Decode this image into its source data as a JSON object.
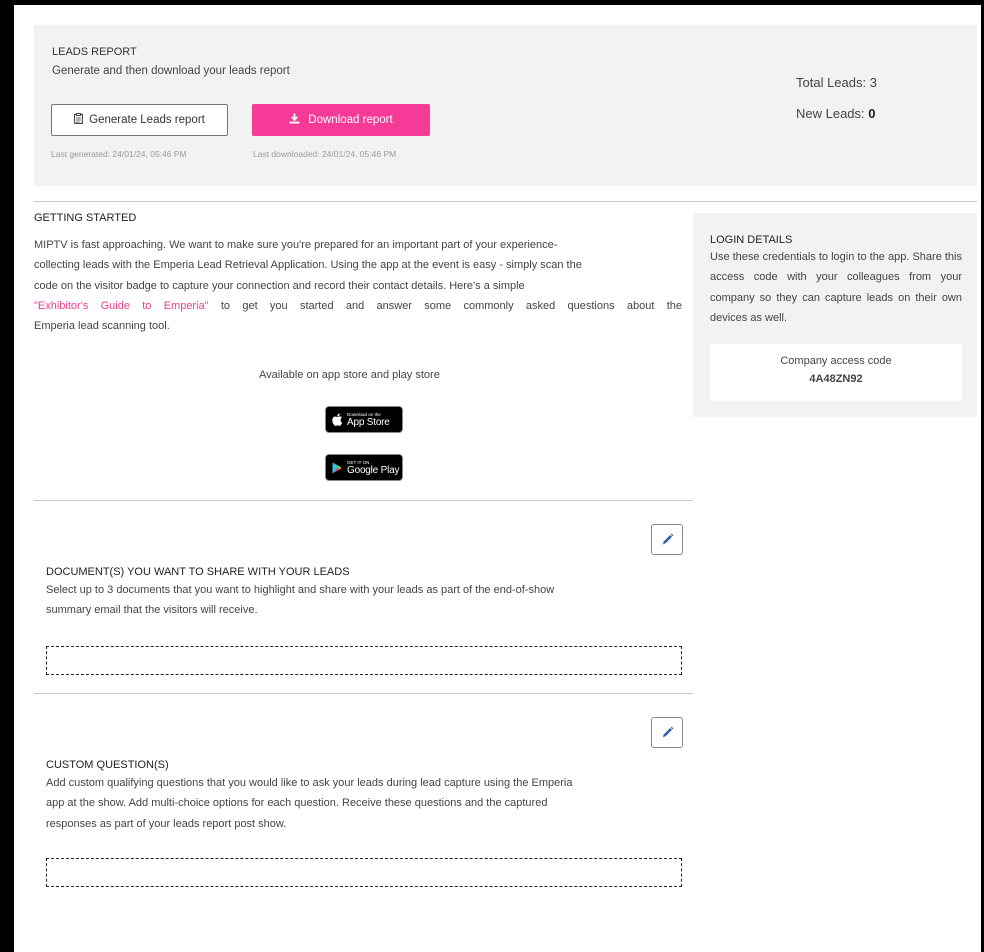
{
  "leads_report": {
    "title": "LEADS REPORT",
    "subtitle": "Generate and then download your leads report",
    "generate_label": "Generate Leads report",
    "download_label": "Download report",
    "last_generated": "Last generated: 24/01/24, 05:46 PM",
    "last_downloaded": "Last downloaded: 24/01/24, 05:46 PM",
    "total_leads_label": "Total Leads: 3",
    "new_leads_label": "New Leads:",
    "new_leads_value": "0",
    "accent_color": "#f53a97"
  },
  "getting_started": {
    "title": "GETTING STARTED",
    "lines": [
      "MIPTV is fast approaching. We want to make sure you're prepared for an important part of your experience-",
      "collecting leads with the Emperia Lead Retrieval Application. Using the app at the event is easy - simply scan the",
      "code on the visitor badge to capture your connection and record their contact details. Here's a simple"
    ],
    "guide_link": "\"Exhibitor's Guide to Emperia\"",
    "line4_rest": "to get you started and answer some commonly asked questions about the",
    "line5": "Emperia lead scanning tool.",
    "stores_caption": "Available on app store and play store",
    "app_store_small": "Download on the",
    "app_store_big": "App Store",
    "play_store_small": "GET IT ON",
    "play_store_big": "Google Play"
  },
  "login_details": {
    "title": "LOGIN DETAILS",
    "text": "Use these credentials to login to the app. Share this access code with your colleagues from your company so they can capture leads on their own devices as well.",
    "code_label": "Company access code",
    "code_value": "4A48ZN92"
  },
  "documents": {
    "title": "DOCUMENT(S) YOU WANT TO SHARE WITH YOUR LEADS",
    "lines": [
      "Select up to 3 documents that you want to highlight and share with your leads as part of the end-of-show",
      "summary email that the visitors will receive."
    ]
  },
  "custom_questions": {
    "title": "CUSTOM QUESTION(S)",
    "lines": [
      "Add custom qualifying questions that you would like to ask your leads during lead capture using the Emperia",
      "app at the show. Add multi-choice options for each question. Receive these questions and the captured",
      "responses as part of your leads report post show."
    ]
  },
  "icons": {
    "generate": "clipboard-icon",
    "download": "download-icon",
    "edit": "pencil-icon",
    "apple": "apple-icon",
    "google_play": "play-triangle-icon"
  }
}
